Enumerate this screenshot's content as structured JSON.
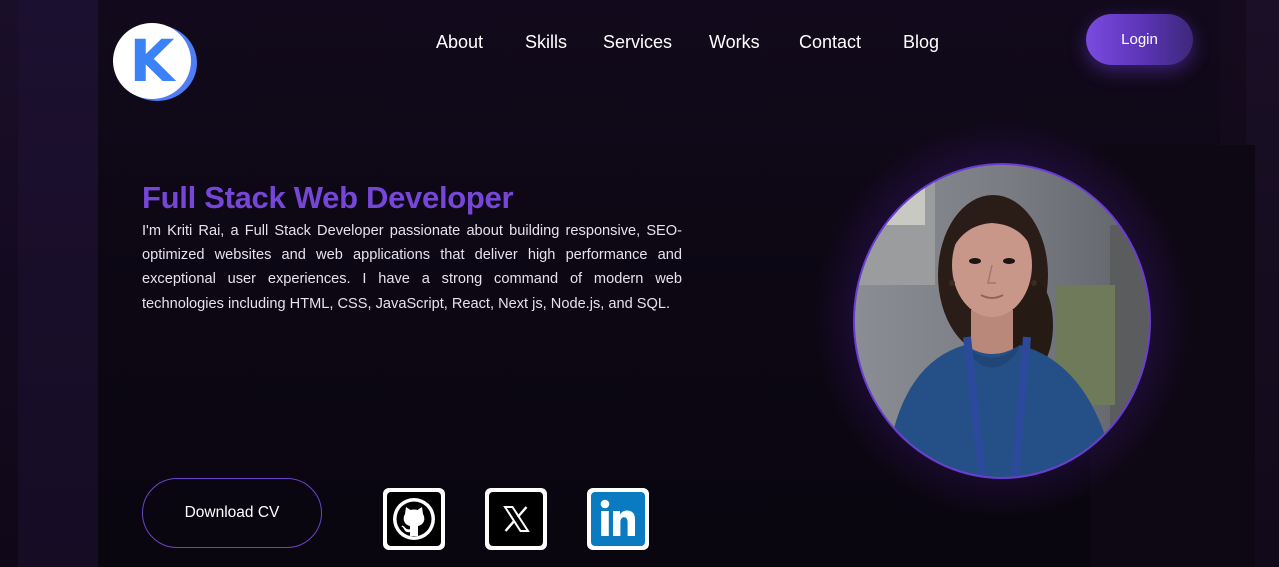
{
  "logo": {
    "letter": "K",
    "icon": "k-letter-logo",
    "colors": {
      "disc": "#ffffff",
      "ring": "#4f7df5",
      "letter": "#3b82f6"
    }
  },
  "nav": {
    "items": [
      "About",
      "Skills",
      "Services",
      "Works",
      "Contact",
      "Blog"
    ],
    "login_label": "Login"
  },
  "hero": {
    "title": "Full Stack Web Developer",
    "description": "I'm Kriti Rai, a Full Stack Developer passionate about building responsive, SEO-optimized websites and web applications that deliver high performance and exceptional user experiences. I have a strong command of modern web technologies including HTML, CSS, JavaScript, React, Next js, Node.js, and SQL.",
    "download_label": "Download CV"
  },
  "social": [
    {
      "name": "GitHub",
      "icon": "github-icon"
    },
    {
      "name": "X",
      "icon": "x-icon"
    },
    {
      "name": "LinkedIn",
      "icon": "linkedin-icon"
    }
  ],
  "portrait": {
    "icon": "profile-photo"
  },
  "colors": {
    "accent": "#7646d8",
    "background": "#0c0712",
    "button_gradient_start": "#7a4be0",
    "button_gradient_end": "#3d2878",
    "linkedin_blue": "#0a66c2"
  }
}
